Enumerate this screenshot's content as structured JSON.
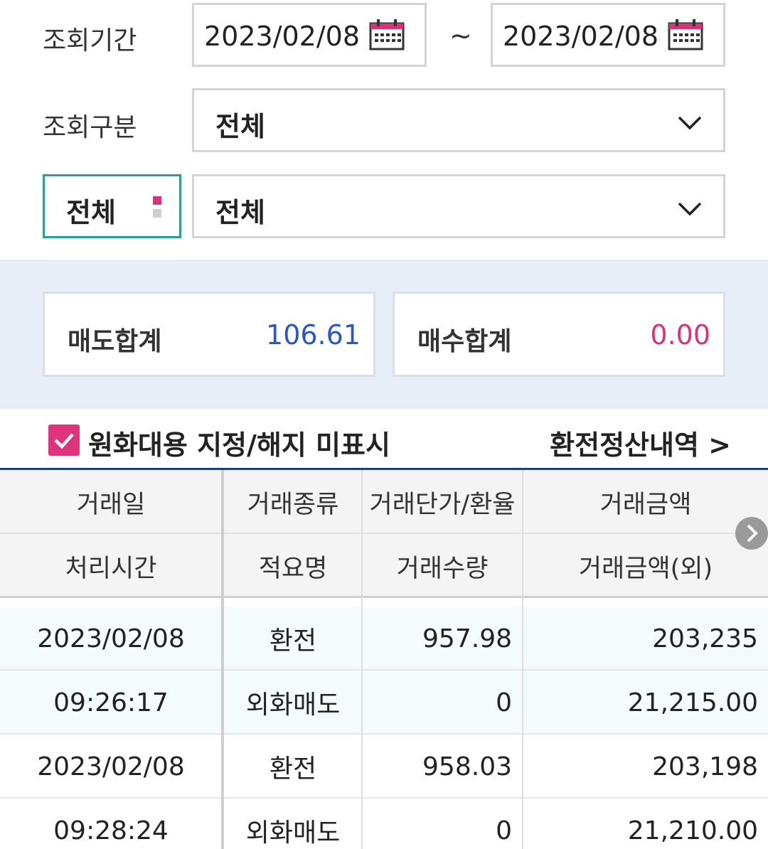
{
  "filters": {
    "period_label": "조회기간",
    "date_from": "2023/02/08",
    "date_separator": "~",
    "date_to": "2023/02/08",
    "type_label": "조회구분",
    "type_value": "전체",
    "currency_filter_btn": "전체",
    "currency_value": "전체"
  },
  "summary": {
    "sell_label": "매도합계",
    "sell_value": "106.61",
    "buy_label": "매수합계",
    "buy_value": "0.00"
  },
  "options": {
    "checkbox_label": "원화대용 지정/해지 미표시",
    "checkbox_checked": true,
    "settlement_link": "환전정산내역 >"
  },
  "table": {
    "headers_row1": [
      "거래일",
      "거래종류",
      "거래단가/환율",
      "거래금액"
    ],
    "headers_row2": [
      "처리시간",
      "적요명",
      "거래수량",
      "거래금액(외)"
    ],
    "rows": [
      [
        "2023/02/08",
        "환전",
        "957.98",
        "203,235"
      ],
      [
        "09:26:17",
        "외화매도",
        "0",
        "21,215.00"
      ],
      [
        "2023/02/08",
        "환전",
        "958.03",
        "203,198"
      ],
      [
        "09:28:24",
        "외화매도",
        "0",
        "21,210.00"
      ]
    ]
  },
  "colors": {
    "accent_teal": "#2a9d9a",
    "sell_blue": "#2b55c9",
    "buy_pink": "#d6337c",
    "table_border_navy": "#1f3e73"
  }
}
